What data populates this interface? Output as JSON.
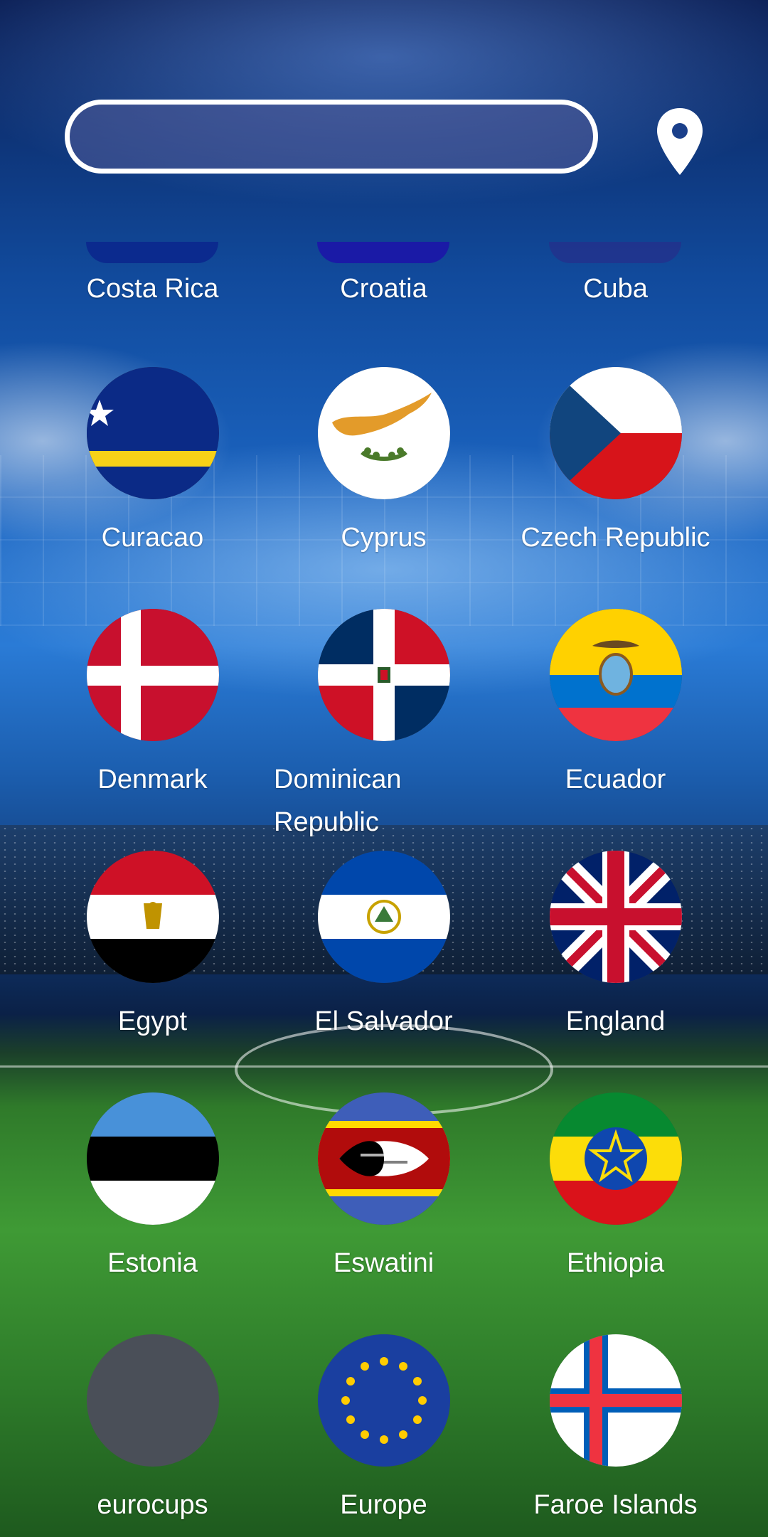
{
  "search": {
    "placeholder": "",
    "value": ""
  },
  "icons": {
    "location": "location-pin-icon"
  },
  "partial_row": [
    {
      "label": "Costa Rica",
      "color": "#0b2a8e"
    },
    {
      "label": "Croatia",
      "color": "#1a1aa6"
    },
    {
      "label": "Cuba",
      "color": "#2a2a88"
    }
  ],
  "countries": [
    {
      "label": "Curacao"
    },
    {
      "label": "Cyprus"
    },
    {
      "label": "Czech Republic"
    },
    {
      "label": "Denmark"
    },
    {
      "label": "Dominican Republic"
    },
    {
      "label": "Ecuador"
    },
    {
      "label": "Egypt"
    },
    {
      "label": "El Salvador"
    },
    {
      "label": "England"
    },
    {
      "label": "Estonia"
    },
    {
      "label": "Eswatini"
    },
    {
      "label": "Ethiopia"
    },
    {
      "label": "eurocups"
    },
    {
      "label": "Europe"
    },
    {
      "label": "Faroe Islands"
    }
  ]
}
